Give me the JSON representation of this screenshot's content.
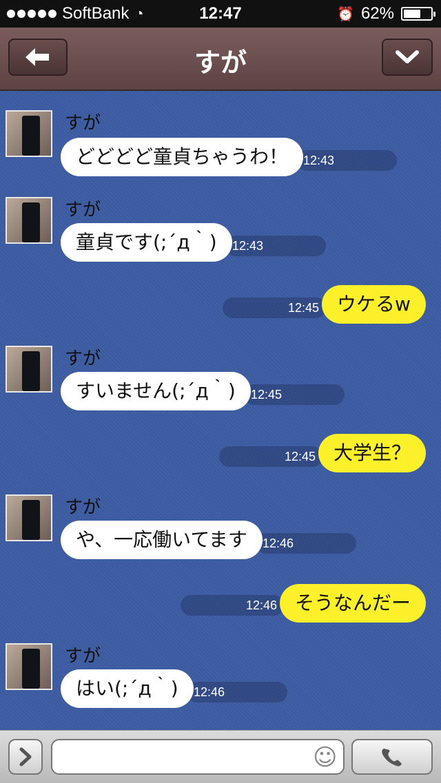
{
  "status_bar": {
    "carrier": "SoftBank",
    "time": "12:47",
    "battery": "62%",
    "battery_level": 0.62
  },
  "header": {
    "title": "すが"
  },
  "messages": [
    {
      "dir": "in",
      "sender": "すが",
      "text": "どどどど童貞ちゃうわ！",
      "time": "12:43"
    },
    {
      "dir": "in",
      "sender": "すが",
      "text": "童貞です(;´д｀)",
      "time": "12:43"
    },
    {
      "dir": "out",
      "text": "ウケるw",
      "time": "12:45"
    },
    {
      "dir": "in",
      "sender": "すが",
      "text": "すいません(;´д｀)",
      "time": "12:45"
    },
    {
      "dir": "out",
      "text": "大学生？",
      "time": "12:45"
    },
    {
      "dir": "in",
      "sender": "すが",
      "text": "や、一応働いてます",
      "time": "12:46"
    },
    {
      "dir": "out",
      "text": "そうなんだー",
      "time": "12:46"
    },
    {
      "dir": "in",
      "sender": "すが",
      "text": "はい(;´д｀)",
      "time": "12:46"
    }
  ],
  "composer": {
    "placeholder": ""
  },
  "icons": {
    "back": "back-arrow-icon",
    "down": "chevron-down-icon",
    "expand": "chevron-right-icon",
    "emoji": "smiley-icon",
    "call": "phone-icon"
  }
}
